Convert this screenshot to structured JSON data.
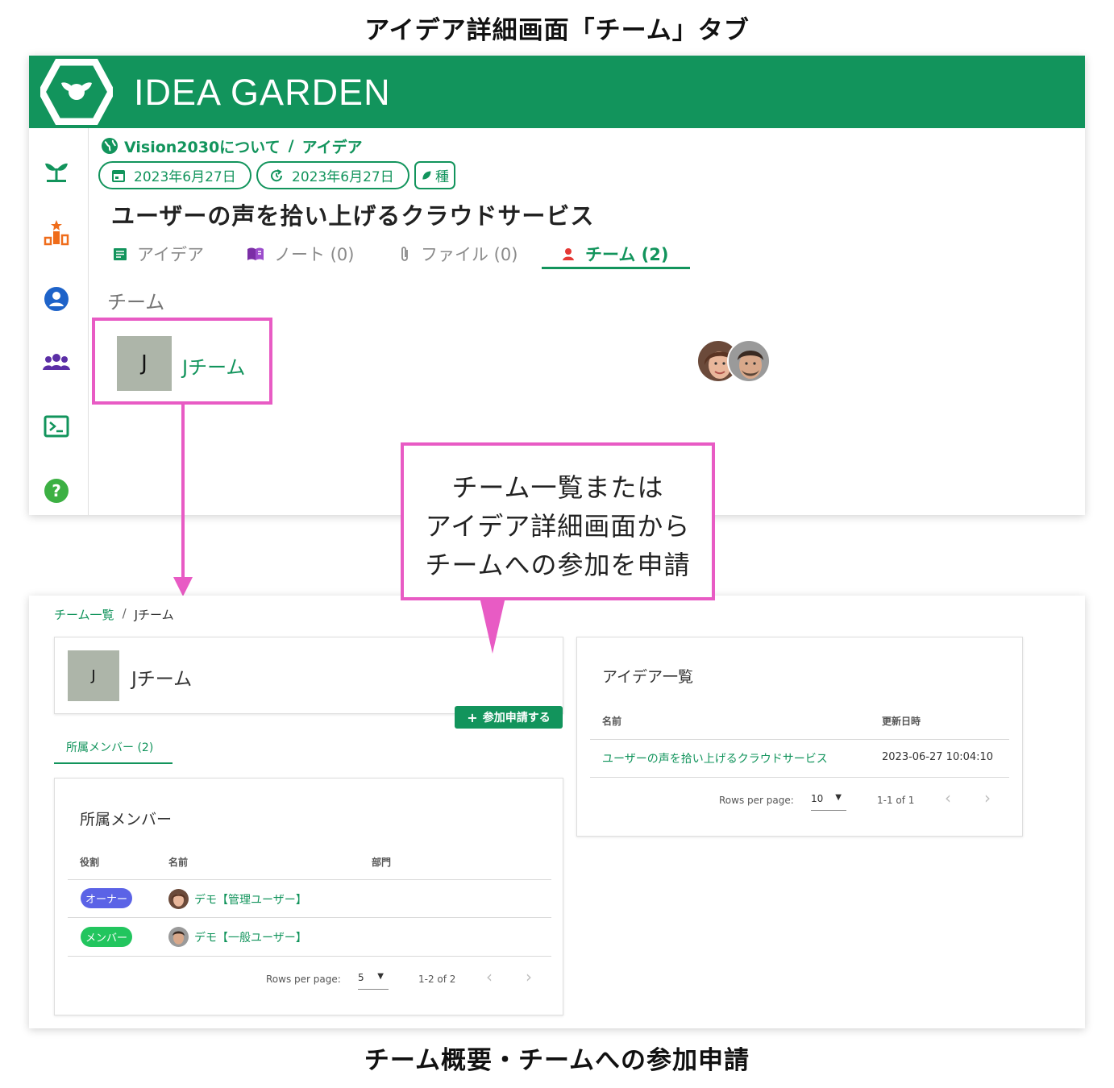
{
  "captions": {
    "top": "アイデア詳細画面「チーム」タブ",
    "bottom": "チーム概要・チームへの参加申請"
  },
  "colors": {
    "brand_green": "#12945c",
    "highlight_pink": "#e85bc4",
    "owner_badge": "#5b63e6",
    "member_badge": "#22c55e"
  },
  "app": {
    "logo_text": "IDEA GARDEN",
    "rail_icons": [
      "sprout-icon",
      "ranking-icon",
      "account-circle-icon",
      "group-icon",
      "terminal-icon",
      "help-icon"
    ]
  },
  "idea_detail": {
    "breadcrumb": {
      "parent": "Vision2030について",
      "separator": "/",
      "current": "アイデア"
    },
    "created_date": "2023年6月27日",
    "updated_date": "2023年6月27日",
    "stage_tag": "種",
    "title": "ユーザーの声を拾い上げるクラウドサービス",
    "tabs": [
      {
        "label": "アイデア"
      },
      {
        "label": "ノート (0)"
      },
      {
        "label": "ファイル (0)"
      },
      {
        "label": "チーム (2)",
        "active": true
      }
    ],
    "team_section_title": "チーム",
    "team": {
      "initial": "J",
      "name": "Jチーム"
    }
  },
  "callout": {
    "line1": "チーム一覧または",
    "line2": "アイデア詳細画面から",
    "line3": "チームへの参加を申請"
  },
  "team_overview": {
    "breadcrumb": {
      "parent": "チーム一覧",
      "separator": "/",
      "current": "Jチーム"
    },
    "team": {
      "initial": "J",
      "name": "Jチーム"
    },
    "join_button_label": "参加申請する",
    "members_tab": "所属メンバー (2)",
    "members_card": {
      "title": "所属メンバー",
      "columns": [
        "役割",
        "名前",
        "部門"
      ],
      "rows": [
        {
          "role": "オーナー",
          "name": "デモ【管理ユーザー】",
          "department": ""
        },
        {
          "role": "メンバー",
          "name": "デモ【一般ユーザー】",
          "department": ""
        }
      ],
      "pagination": {
        "rows_per_page_label": "Rows per page:",
        "rows_per_page": "5",
        "range": "1-2 of 2"
      }
    },
    "ideas_card": {
      "title": "アイデア一覧",
      "columns": [
        "名前",
        "更新日時"
      ],
      "rows": [
        {
          "name": "ユーザーの声を拾い上げるクラウドサービス",
          "updated": "2023-06-27 10:04:10"
        }
      ],
      "pagination": {
        "rows_per_page_label": "Rows per page:",
        "rows_per_page": "10",
        "range": "1-1 of 1"
      }
    }
  }
}
